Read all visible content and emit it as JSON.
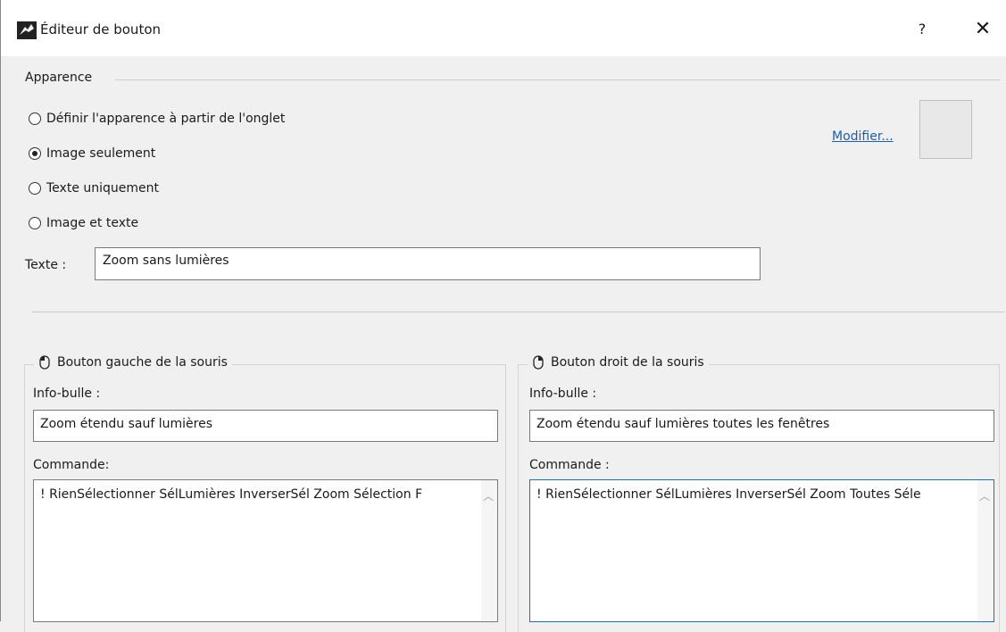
{
  "window": {
    "title": "Éditeur de bouton",
    "help_label": "?",
    "close_label": "✕"
  },
  "appearance": {
    "section_label": "Apparence",
    "options": [
      {
        "label": "Définir l'apparence à partir de l'onglet",
        "checked": false
      },
      {
        "label": "Image seulement",
        "checked": true
      },
      {
        "label": "Texte uniquement",
        "checked": false
      },
      {
        "label": "Image et texte",
        "checked": false
      }
    ],
    "modify_link": "Modifier...",
    "text_label": "Texte :",
    "text_value": "Zoom sans lumières"
  },
  "left_button": {
    "title": "Bouton gauche de la souris",
    "tooltip_label": "Info-bulle :",
    "tooltip_value": "Zoom étendu sauf lumières",
    "command_label": "Commande:",
    "command_value": "! RienSélectionner SélLumières InverserSél Zoom Sélection F"
  },
  "right_button": {
    "title": "Bouton droit de la souris",
    "tooltip_label": "Info-bulle :",
    "tooltip_value": "Zoom étendu sauf lumières toutes les fenêtres",
    "command_label": "Commande :",
    "command_value": "! RienSélectionner SélLumières InverserSél Zoom Toutes Séle"
  },
  "icons": {
    "app": "rhino-app-icon",
    "mouse_left": "mouse-left-button-icon",
    "mouse_right": "mouse-right-button-icon"
  },
  "colors": {
    "link": "#1a5fb4",
    "focus_border": "#1e6fb4"
  }
}
